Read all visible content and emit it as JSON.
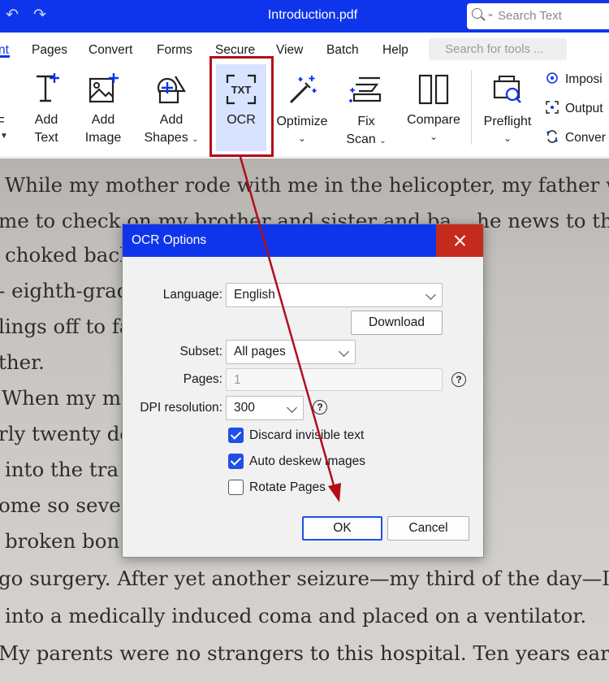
{
  "titlebar": {
    "document_title": "Introduction.pdf",
    "search_placeholder": "Search Text",
    "icons": [
      "undo-icon",
      "redo-icon",
      "search-icon"
    ]
  },
  "menu": {
    "items": [
      "nt",
      "Pages",
      "Convert",
      "Forms",
      "Secure",
      "View",
      "Batch",
      "Help"
    ],
    "tools_search_placeholder": "Search for tools ..."
  },
  "ribbon": {
    "left_fragment": "F",
    "add_text": [
      "Add",
      "Text"
    ],
    "add_image": [
      "Add",
      "Image"
    ],
    "add_shapes": [
      "Add",
      "Shapes"
    ],
    "ocr": "OCR",
    "ocr_icon_text": "TXT",
    "optimize": "Optimize",
    "fix_scan": [
      "Fix",
      "Scan"
    ],
    "compare": "Compare",
    "preflight": "Preflight",
    "side": [
      "Imposi",
      "Output",
      "Conver"
    ]
  },
  "document": {
    "lines": [
      "While my mother rode with me in the helicopter, my father w",
      "me to check on my brother and sister and ba... he news to th",
      "choked back ...                                at he would r",
      "- eighth-grad                                   After passing",
      "lings off to fa                                 nnati to meet",
      "ther.",
      "When my m                                     hospital, a tear",
      "rly twenty do                                 ilipad and whe",
      "into the tra                                  in my brain",
      "ome so seve                                   raumatic seiz",
      "broken bon                                    condition to",
      "go surgery. After yet another seizure—my third of the day—I",
      "into a medically induced coma and placed on a ventilator.",
      "My parents were no strangers to this hospital. Ten years earlier,"
    ]
  },
  "dialog": {
    "title": "OCR Options",
    "language_label": "Language:",
    "language_value": "English",
    "download_label": "Download",
    "subset_label": "Subset:",
    "subset_value": "All pages",
    "pages_label": "Pages:",
    "pages_value": "1",
    "dpi_label": "DPI resolution:",
    "dpi_value": "300",
    "help_glyph": "?",
    "discard_label": "Discard invisible text",
    "discard_checked": true,
    "deskew_label": "Auto deskew images",
    "deskew_checked": true,
    "rotate_label": "Rotate Pages",
    "rotate_checked": false,
    "ok_label": "OK",
    "cancel_label": "Cancel"
  },
  "colors": {
    "brand_blue": "#0f35ec",
    "annotation_red": "#b30d1a",
    "close_red": "#c42b1c",
    "checkbox_blue": "#1f4fe6",
    "ocr_highlight": "#d7e3ff"
  }
}
